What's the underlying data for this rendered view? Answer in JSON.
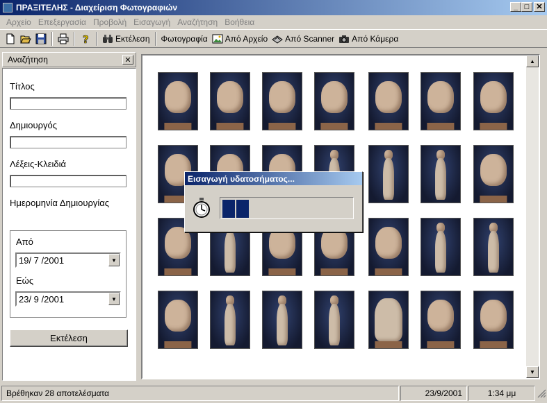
{
  "window": {
    "title": "ΠΡΑΞΙΤΕΛΗΣ - Διαχείριση Φωτογραφιών",
    "minimize": "_",
    "maximize": "□",
    "close": "✕"
  },
  "menu": [
    "Αρχείο",
    "Επεξεργασία",
    "Προβολή",
    "Εισαγωγή",
    "Αναζήτηση",
    "Βοήθεια"
  ],
  "toolbar": {
    "execute_label": "Εκτέλεση",
    "photo_label": "Φωτογραφία",
    "from_file_label": "Από Αρχείο",
    "from_scanner_label": "Από Scanner",
    "from_camera_label": "Από Κάμερα"
  },
  "search_panel": {
    "title": "Αναζήτηση",
    "title_label": "Τίτλος",
    "title_value": "",
    "creator_label": "Δημιουργός",
    "creator_value": "",
    "keywords_label": "Λέξεις-Κλειδιά",
    "keywords_value": "",
    "date_label": "Ημερομηνία Δημιουργίας",
    "from_label": "Από",
    "from_value": "19/ 7 /2001",
    "to_label": "Εώς",
    "to_value": "23/ 9 /2001",
    "execute_button": "Εκτέλεση"
  },
  "gallery": {
    "photo_count": 28,
    "photos": [
      {
        "kind": "head"
      },
      {
        "kind": "head"
      },
      {
        "kind": "head"
      },
      {
        "kind": "head"
      },
      {
        "kind": "head"
      },
      {
        "kind": "head"
      },
      {
        "kind": "head"
      },
      {
        "kind": "head"
      },
      {
        "kind": "head"
      },
      {
        "kind": "head"
      },
      {
        "kind": "statue"
      },
      {
        "kind": "statue"
      },
      {
        "kind": "statue"
      },
      {
        "kind": "head"
      },
      {
        "kind": "head"
      },
      {
        "kind": "statue"
      },
      {
        "kind": "head"
      },
      {
        "kind": "head"
      },
      {
        "kind": "head"
      },
      {
        "kind": "statue"
      },
      {
        "kind": "statue"
      },
      {
        "kind": "head"
      },
      {
        "kind": "statue"
      },
      {
        "kind": "statue"
      },
      {
        "kind": "statue"
      },
      {
        "kind": "torso"
      },
      {
        "kind": "head"
      },
      {
        "kind": "head"
      }
    ]
  },
  "dialog": {
    "title": "Εισαγωγή υδατοσήματος...",
    "progress": 0.2
  },
  "status": {
    "message": "Βρέθηκαν 28 αποτελέσματα",
    "date": "23/9/2001",
    "time": "1:34 μμ"
  }
}
